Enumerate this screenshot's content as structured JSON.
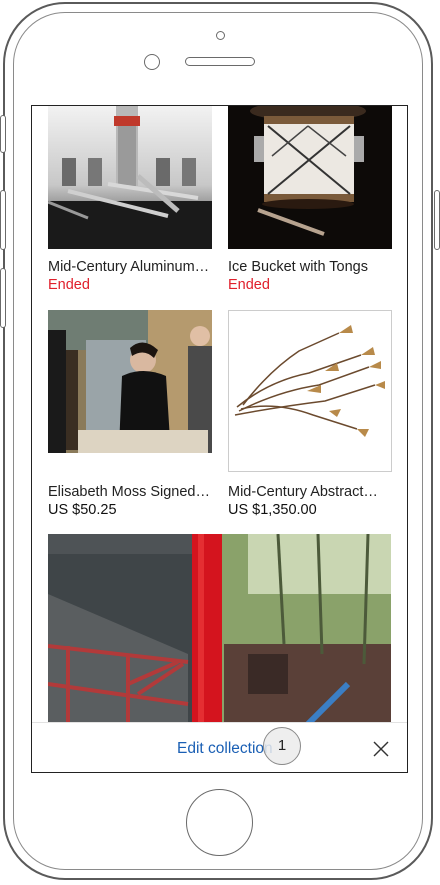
{
  "items": [
    {
      "title": "Mid-Century Aluminum…",
      "status": "Ended"
    },
    {
      "title": "Ice Bucket with Tongs",
      "status": "Ended"
    },
    {
      "title": "Elisabeth Moss Signed…",
      "price": "US $50.25"
    },
    {
      "title": "Mid-Century Abstract…",
      "price": "US $1,350.00"
    }
  ],
  "bottom_bar": {
    "edit_label": "Edit collection",
    "close_icon": "close-icon"
  },
  "touch_badge": "1",
  "colors": {
    "ended": "#e0202c",
    "link": "#1a5fb4"
  }
}
